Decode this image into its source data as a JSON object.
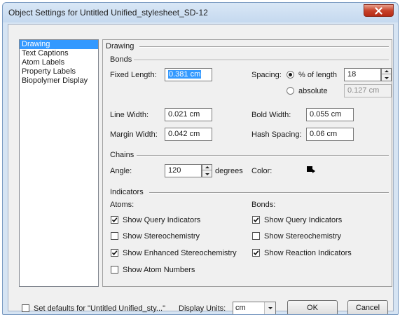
{
  "window": {
    "title": "Object Settings for Untitled Unified_stylesheet_SD-12"
  },
  "categories": [
    {
      "label": "Drawing",
      "selected": true
    },
    {
      "label": "Text Captions",
      "selected": false
    },
    {
      "label": "Atom Labels",
      "selected": false
    },
    {
      "label": "Property Labels",
      "selected": false
    },
    {
      "label": "Biopolymer Display",
      "selected": false
    }
  ],
  "drawing": {
    "group_title": "Drawing",
    "bonds": {
      "title": "Bonds",
      "fixed_length_label": "Fixed Length:",
      "fixed_length_value": "0.381 cm",
      "spacing_label": "Spacing:",
      "spacing_percent_label": "% of length",
      "spacing_percent_value": "18",
      "spacing_absolute_label": "absolute",
      "spacing_absolute_value": "0.127 cm",
      "spacing_mode": "percent",
      "line_width_label": "Line Width:",
      "line_width_value": "0.021 cm",
      "bold_width_label": "Bold Width:",
      "bold_width_value": "0.055 cm",
      "margin_width_label": "Margin Width:",
      "margin_width_value": "0.042 cm",
      "hash_spacing_label": "Hash Spacing:",
      "hash_spacing_value": "0.06 cm"
    },
    "chains": {
      "title": "Chains",
      "angle_label": "Angle:",
      "angle_value": "120",
      "angle_unit": "degrees",
      "color_label": "Color:",
      "color_value": "#000000"
    },
    "indicators": {
      "title": "Indicators",
      "atoms_label": "Atoms:",
      "bonds_label": "Bonds:",
      "atoms": [
        {
          "label": "Show Query Indicators",
          "checked": true
        },
        {
          "label": "Show Stereochemistry",
          "checked": false
        },
        {
          "label": "Show Enhanced Stereochemistry",
          "checked": true
        },
        {
          "label": "Show Atom Numbers",
          "checked": false
        }
      ],
      "bonds": [
        {
          "label": "Show Query Indicators",
          "checked": true
        },
        {
          "label": "Show Stereochemistry",
          "checked": false
        },
        {
          "label": "Show Reaction Indicators",
          "checked": true
        }
      ]
    }
  },
  "footer": {
    "set_defaults_label": "Set defaults for \"Untitled Unified_sty...\"",
    "set_defaults_checked": false,
    "display_units_label": "Display Units:",
    "display_units_value": "cm",
    "ok_label": "OK",
    "cancel_label": "Cancel"
  }
}
